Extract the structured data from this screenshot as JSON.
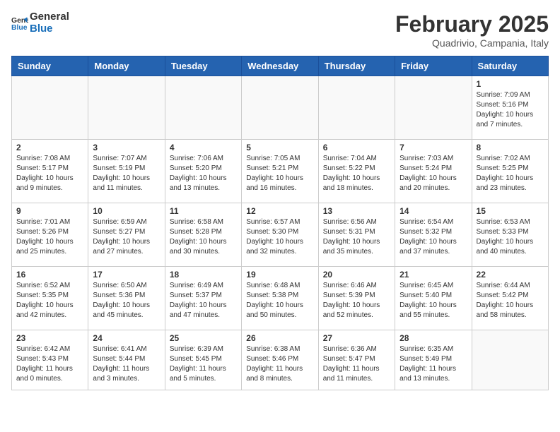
{
  "header": {
    "logo_line1": "General",
    "logo_line2": "Blue",
    "month": "February 2025",
    "location": "Quadrivio, Campania, Italy"
  },
  "weekdays": [
    "Sunday",
    "Monday",
    "Tuesday",
    "Wednesday",
    "Thursday",
    "Friday",
    "Saturday"
  ],
  "weeks": [
    [
      {
        "day": "",
        "info": ""
      },
      {
        "day": "",
        "info": ""
      },
      {
        "day": "",
        "info": ""
      },
      {
        "day": "",
        "info": ""
      },
      {
        "day": "",
        "info": ""
      },
      {
        "day": "",
        "info": ""
      },
      {
        "day": "1",
        "info": "Sunrise: 7:09 AM\nSunset: 5:16 PM\nDaylight: 10 hours and 7 minutes."
      }
    ],
    [
      {
        "day": "2",
        "info": "Sunrise: 7:08 AM\nSunset: 5:17 PM\nDaylight: 10 hours and 9 minutes."
      },
      {
        "day": "3",
        "info": "Sunrise: 7:07 AM\nSunset: 5:19 PM\nDaylight: 10 hours and 11 minutes."
      },
      {
        "day": "4",
        "info": "Sunrise: 7:06 AM\nSunset: 5:20 PM\nDaylight: 10 hours and 13 minutes."
      },
      {
        "day": "5",
        "info": "Sunrise: 7:05 AM\nSunset: 5:21 PM\nDaylight: 10 hours and 16 minutes."
      },
      {
        "day": "6",
        "info": "Sunrise: 7:04 AM\nSunset: 5:22 PM\nDaylight: 10 hours and 18 minutes."
      },
      {
        "day": "7",
        "info": "Sunrise: 7:03 AM\nSunset: 5:24 PM\nDaylight: 10 hours and 20 minutes."
      },
      {
        "day": "8",
        "info": "Sunrise: 7:02 AM\nSunset: 5:25 PM\nDaylight: 10 hours and 23 minutes."
      }
    ],
    [
      {
        "day": "9",
        "info": "Sunrise: 7:01 AM\nSunset: 5:26 PM\nDaylight: 10 hours and 25 minutes."
      },
      {
        "day": "10",
        "info": "Sunrise: 6:59 AM\nSunset: 5:27 PM\nDaylight: 10 hours and 27 minutes."
      },
      {
        "day": "11",
        "info": "Sunrise: 6:58 AM\nSunset: 5:28 PM\nDaylight: 10 hours and 30 minutes."
      },
      {
        "day": "12",
        "info": "Sunrise: 6:57 AM\nSunset: 5:30 PM\nDaylight: 10 hours and 32 minutes."
      },
      {
        "day": "13",
        "info": "Sunrise: 6:56 AM\nSunset: 5:31 PM\nDaylight: 10 hours and 35 minutes."
      },
      {
        "day": "14",
        "info": "Sunrise: 6:54 AM\nSunset: 5:32 PM\nDaylight: 10 hours and 37 minutes."
      },
      {
        "day": "15",
        "info": "Sunrise: 6:53 AM\nSunset: 5:33 PM\nDaylight: 10 hours and 40 minutes."
      }
    ],
    [
      {
        "day": "16",
        "info": "Sunrise: 6:52 AM\nSunset: 5:35 PM\nDaylight: 10 hours and 42 minutes."
      },
      {
        "day": "17",
        "info": "Sunrise: 6:50 AM\nSunset: 5:36 PM\nDaylight: 10 hours and 45 minutes."
      },
      {
        "day": "18",
        "info": "Sunrise: 6:49 AM\nSunset: 5:37 PM\nDaylight: 10 hours and 47 minutes."
      },
      {
        "day": "19",
        "info": "Sunrise: 6:48 AM\nSunset: 5:38 PM\nDaylight: 10 hours and 50 minutes."
      },
      {
        "day": "20",
        "info": "Sunrise: 6:46 AM\nSunset: 5:39 PM\nDaylight: 10 hours and 52 minutes."
      },
      {
        "day": "21",
        "info": "Sunrise: 6:45 AM\nSunset: 5:40 PM\nDaylight: 10 hours and 55 minutes."
      },
      {
        "day": "22",
        "info": "Sunrise: 6:44 AM\nSunset: 5:42 PM\nDaylight: 10 hours and 58 minutes."
      }
    ],
    [
      {
        "day": "23",
        "info": "Sunrise: 6:42 AM\nSunset: 5:43 PM\nDaylight: 11 hours and 0 minutes."
      },
      {
        "day": "24",
        "info": "Sunrise: 6:41 AM\nSunset: 5:44 PM\nDaylight: 11 hours and 3 minutes."
      },
      {
        "day": "25",
        "info": "Sunrise: 6:39 AM\nSunset: 5:45 PM\nDaylight: 11 hours and 5 minutes."
      },
      {
        "day": "26",
        "info": "Sunrise: 6:38 AM\nSunset: 5:46 PM\nDaylight: 11 hours and 8 minutes."
      },
      {
        "day": "27",
        "info": "Sunrise: 6:36 AM\nSunset: 5:47 PM\nDaylight: 11 hours and 11 minutes."
      },
      {
        "day": "28",
        "info": "Sunrise: 6:35 AM\nSunset: 5:49 PM\nDaylight: 11 hours and 13 minutes."
      },
      {
        "day": "",
        "info": ""
      }
    ]
  ]
}
